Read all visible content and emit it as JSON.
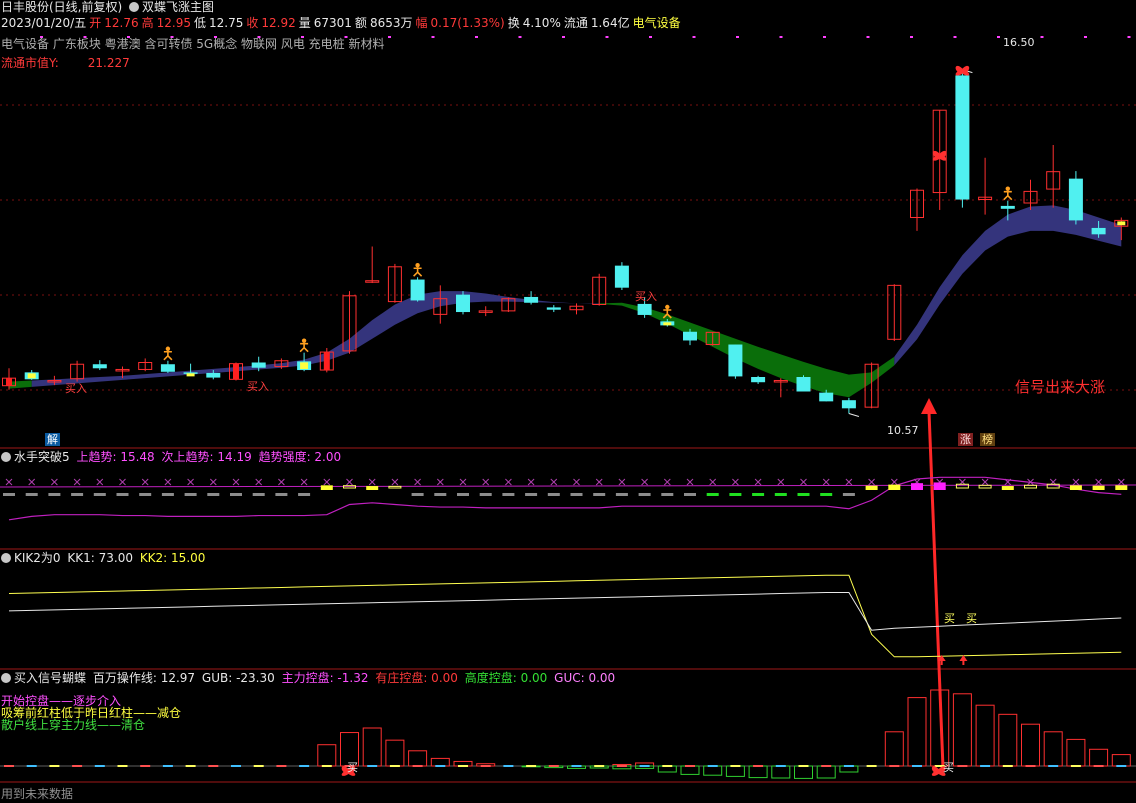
{
  "header": {
    "stock": "日丰股份(日线,前复权)",
    "template": "双蝶飞涨主图",
    "date": "2023/01/20/五",
    "open_label": "开",
    "open": "12.76",
    "high_label": "高",
    "high": "12.95",
    "low_label": "低",
    "low": "12.75",
    "close_label": "收",
    "close": "12.92",
    "vol_label": "量",
    "vol": "67301",
    "amount_label": "额",
    "amount": "8653万",
    "chg_label": "幅",
    "chg": "0.17(1.33%)",
    "turnover_label": "换",
    "turnover": "4.10%",
    "float_label": "流通",
    "float": "1.64亿",
    "sector": "电气设备",
    "concepts": "电气设备 广东板块 粤港澳 含可转债 5G概念 物联网 风电 充电桩 新材料",
    "mcap_label": "流通市值Y:",
    "mcap": "21.227"
  },
  "annotations": {
    "buy1": "买入",
    "buy2": "买入",
    "buy3": "买入",
    "high_price": "16.50",
    "low_price": "10.57",
    "signal_text": "信号出来大涨",
    "jie": "解",
    "zhang": "涨",
    "bang": "榜"
  },
  "panel2": {
    "name": "水手突破5",
    "l1": "上趋势: 15.48",
    "l2": "次上趋势: 14.19",
    "l3": "趋势强度: 2.00"
  },
  "panel3": {
    "name": "KIK2为0",
    "l1": "KK1: 73.00",
    "l2": "KK2: 15.00",
    "buy_a": "买",
    "buy_b": "买"
  },
  "panel4": {
    "name": "买入信号蝴蝶",
    "l1": "百万操作线: 12.97",
    "l2": "GUB: -23.30",
    "l3": "主力控盘: -1.32",
    "l4": "有庄控盘: 0.00",
    "l5": "高度控盘: 0.00",
    "l6": "GUC: 0.00",
    "legend1": "开始控盘——逐步介入",
    "legend2": "吸筹前红柱低于昨日红柱——减仓",
    "legend3": "散户线上穿主力线——清仓",
    "buy_mark1": "买",
    "buy_mark2": "买",
    "footer": "用到未来数据"
  },
  "colors": {
    "up": "#ff3030",
    "down": "#50f0f0",
    "band_up": "#34347c",
    "band_down": "#0a6e0a",
    "grid": "#7a1010",
    "sep": "#a01818"
  },
  "chart_data": {
    "type": "candlestick",
    "x_count": 50,
    "ylim": [
      10.2,
      16.7
    ],
    "candles": [
      {
        "o": 11.05,
        "h": 11.35,
        "l": 10.98,
        "c": 11.18
      },
      {
        "o": 11.28,
        "h": 11.32,
        "l": 11.15,
        "c": 11.16
      },
      {
        "o": 11.12,
        "h": 11.22,
        "l": 11.06,
        "c": 11.14
      },
      {
        "o": 11.17,
        "h": 11.48,
        "l": 11.12,
        "c": 11.42
      },
      {
        "o": 11.42,
        "h": 11.49,
        "l": 11.32,
        "c": 11.35
      },
      {
        "o": 11.32,
        "h": 11.38,
        "l": 11.18,
        "c": 11.33
      },
      {
        "o": 11.33,
        "h": 11.52,
        "l": 11.3,
        "c": 11.45
      },
      {
        "o": 11.42,
        "h": 11.48,
        "l": 11.27,
        "c": 11.29
      },
      {
        "o": 11.28,
        "h": 11.43,
        "l": 11.22,
        "c": 11.26
      },
      {
        "o": 11.27,
        "h": 11.32,
        "l": 11.16,
        "c": 11.19
      },
      {
        "o": 11.16,
        "h": 11.45,
        "l": 11.14,
        "c": 11.43
      },
      {
        "o": 11.45,
        "h": 11.55,
        "l": 11.3,
        "c": 11.36
      },
      {
        "o": 11.38,
        "h": 11.52,
        "l": 11.34,
        "c": 11.48
      },
      {
        "o": 11.47,
        "h": 11.62,
        "l": 11.3,
        "c": 11.32
      },
      {
        "o": 11.32,
        "h": 11.7,
        "l": 11.28,
        "c": 11.63
      },
      {
        "o": 11.65,
        "h": 12.68,
        "l": 11.6,
        "c": 12.6
      },
      {
        "o": 12.85,
        "h": 13.45,
        "l": 12.82,
        "c": 12.86
      },
      {
        "o": 12.5,
        "h": 13.15,
        "l": 12.48,
        "c": 13.1
      },
      {
        "o": 12.88,
        "h": 12.92,
        "l": 12.5,
        "c": 12.52
      },
      {
        "o": 12.28,
        "h": 12.78,
        "l": 12.12,
        "c": 12.55
      },
      {
        "o": 12.62,
        "h": 12.68,
        "l": 12.28,
        "c": 12.32
      },
      {
        "o": 12.33,
        "h": 12.42,
        "l": 12.25,
        "c": 12.34
      },
      {
        "o": 12.34,
        "h": 12.57,
        "l": 12.32,
        "c": 12.55
      },
      {
        "o": 12.58,
        "h": 12.68,
        "l": 12.45,
        "c": 12.48
      },
      {
        "o": 12.4,
        "h": 12.44,
        "l": 12.32,
        "c": 12.36
      },
      {
        "o": 12.36,
        "h": 12.47,
        "l": 12.28,
        "c": 12.42
      },
      {
        "o": 12.45,
        "h": 12.98,
        "l": 12.43,
        "c": 12.92
      },
      {
        "o": 13.12,
        "h": 13.18,
        "l": 12.7,
        "c": 12.74
      },
      {
        "o": 12.46,
        "h": 12.58,
        "l": 12.22,
        "c": 12.27
      },
      {
        "o": 12.16,
        "h": 12.2,
        "l": 12.07,
        "c": 12.09
      },
      {
        "o": 11.98,
        "h": 12.03,
        "l": 11.75,
        "c": 11.83
      },
      {
        "o": 11.76,
        "h": 11.97,
        "l": 11.74,
        "c": 11.97
      },
      {
        "o": 11.76,
        "h": 11.76,
        "l": 11.17,
        "c": 11.21
      },
      {
        "o": 11.2,
        "h": 11.22,
        "l": 11.08,
        "c": 11.11
      },
      {
        "o": 11.14,
        "h": 11.18,
        "l": 10.85,
        "c": 11.14
      },
      {
        "o": 11.2,
        "h": 11.23,
        "l": 10.95,
        "c": 10.95
      },
      {
        "o": 10.93,
        "h": 10.98,
        "l": 10.78,
        "c": 10.78
      },
      {
        "o": 10.8,
        "h": 10.84,
        "l": 10.57,
        "c": 10.66
      },
      {
        "o": 10.68,
        "h": 11.45,
        "l": 10.66,
        "c": 11.42
      },
      {
        "o": 11.85,
        "h": 12.8,
        "l": 11.82,
        "c": 12.78
      },
      {
        "o": 13.95,
        "h": 14.45,
        "l": 13.72,
        "c": 14.42
      },
      {
        "o": 14.38,
        "h": 15.8,
        "l": 14.08,
        "c": 15.8
      },
      {
        "o": 16.4,
        "h": 16.5,
        "l": 14.12,
        "c": 14.26
      },
      {
        "o": 14.26,
        "h": 14.98,
        "l": 14.0,
        "c": 14.3
      },
      {
        "o": 14.15,
        "h": 14.24,
        "l": 13.9,
        "c": 14.1
      },
      {
        "o": 14.2,
        "h": 14.6,
        "l": 14.08,
        "c": 14.4
      },
      {
        "o": 14.44,
        "h": 15.2,
        "l": 14.12,
        "c": 14.74
      },
      {
        "o": 14.62,
        "h": 14.75,
        "l": 13.83,
        "c": 13.9
      },
      {
        "o": 13.77,
        "h": 13.89,
        "l": 13.6,
        "c": 13.66
      },
      {
        "o": 13.8,
        "h": 13.95,
        "l": 13.56,
        "c": 13.9
      }
    ],
    "band_top": [
      11.12,
      11.14,
      11.16,
      11.18,
      11.2,
      11.22,
      11.25,
      11.28,
      11.31,
      11.34,
      11.37,
      11.4,
      11.44,
      11.5,
      11.62,
      11.86,
      12.18,
      12.45,
      12.62,
      12.68,
      12.68,
      12.64,
      12.58,
      12.53,
      12.49,
      12.47,
      12.47,
      12.48,
      12.4,
      12.28,
      12.14,
      12.0,
      11.86,
      11.72,
      11.59,
      11.46,
      11.34,
      11.24,
      11.28,
      11.55,
      12.1,
      12.75,
      13.3,
      13.72,
      14.0,
      14.14,
      14.16,
      14.08,
      13.95,
      13.82
    ],
    "band_bot": [
      11.0,
      11.03,
      11.06,
      11.09,
      11.12,
      11.15,
      11.18,
      11.21,
      11.24,
      11.27,
      11.3,
      11.33,
      11.36,
      11.4,
      11.48,
      11.62,
      11.86,
      12.1,
      12.3,
      12.42,
      12.48,
      12.5,
      12.5,
      12.49,
      12.48,
      12.47,
      12.46,
      12.43,
      12.3,
      12.12,
      11.92,
      11.72,
      11.52,
      11.34,
      11.18,
      11.04,
      10.92,
      10.85,
      11.1,
      11.4,
      11.85,
      12.45,
      12.98,
      13.38,
      13.62,
      13.72,
      13.72,
      13.65,
      13.55,
      13.45
    ],
    "panel2_purple": [
      0.32,
      0.36,
      0.38,
      0.38,
      0.38,
      0.37,
      0.37,
      0.36,
      0.36,
      0.36,
      0.36,
      0.37,
      0.37,
      0.37,
      0.38,
      0.5,
      0.52,
      0.5,
      0.48,
      0.47,
      0.47,
      0.46,
      0.46,
      0.46,
      0.46,
      0.46,
      0.46,
      0.48,
      0.48,
      0.48,
      0.48,
      0.48,
      0.48,
      0.48,
      0.48,
      0.48,
      0.48,
      0.45,
      0.55,
      0.72,
      0.8,
      0.82,
      0.82,
      0.82,
      0.79,
      0.76,
      0.73,
      0.68,
      0.64,
      0.62
    ],
    "panel2_bars": [
      {
        "k": "gray",
        "v": 0.18
      },
      {
        "k": "gray",
        "v": 0.16
      },
      {
        "k": "gray",
        "v": 0.14
      },
      {
        "k": "gray",
        "v": 0.14
      },
      {
        "k": "gray",
        "v": 0.16
      },
      {
        "k": "gray",
        "v": 0.14
      },
      {
        "k": "gray",
        "v": 0.16
      },
      {
        "k": "gray",
        "v": 0.16
      },
      {
        "k": "gray",
        "v": 0.18
      },
      {
        "k": "gray",
        "v": 0.14
      },
      {
        "k": "gray",
        "v": 0.18
      },
      {
        "k": "gray",
        "v": 0.16
      },
      {
        "k": "gray",
        "v": 0.18
      },
      {
        "k": "gray",
        "v": 0.2
      },
      {
        "k": "yellow",
        "v": 0.26
      },
      {
        "k": "open",
        "v": 0.24
      },
      {
        "k": "yellow",
        "v": 0.22
      },
      {
        "k": "open",
        "v": 0.2
      },
      {
        "k": "gray",
        "v": 0.18
      },
      {
        "k": "gray",
        "v": 0.2
      },
      {
        "k": "gray",
        "v": 0.22
      },
      {
        "k": "gray",
        "v": 0.22
      },
      {
        "k": "gray",
        "v": 0.22
      },
      {
        "k": "gray",
        "v": 0.2
      },
      {
        "k": "gray",
        "v": 0.2
      },
      {
        "k": "gray",
        "v": 0.22
      },
      {
        "k": "gray",
        "v": 0.24
      },
      {
        "k": "gray",
        "v": 0.26
      },
      {
        "k": "gray",
        "v": 0.2
      },
      {
        "k": "gray",
        "v": 0.18
      },
      {
        "k": "gray",
        "v": 0.16
      },
      {
        "k": "green",
        "v": 0.16
      },
      {
        "k": "green",
        "v": 0.16
      },
      {
        "k": "green",
        "v": 0.18
      },
      {
        "k": "green",
        "v": 0.18
      },
      {
        "k": "green",
        "v": 0.16
      },
      {
        "k": "green",
        "v": 0.16
      },
      {
        "k": "gray",
        "v": 0.22
      },
      {
        "k": "yellow",
        "v": 0.24
      },
      {
        "k": "yellow",
        "v": 0.3
      },
      {
        "k": "magenta",
        "v": 0.38
      },
      {
        "k": "magenta",
        "v": 0.42
      },
      {
        "k": "open",
        "v": 0.32
      },
      {
        "k": "open",
        "v": 0.26
      },
      {
        "k": "yellow",
        "v": 0.22
      },
      {
        "k": "open",
        "v": 0.26
      },
      {
        "k": "open",
        "v": 0.32
      },
      {
        "k": "yellow",
        "v": 0.26
      },
      {
        "k": "yellow",
        "v": 0.24
      },
      {
        "k": "yellow",
        "v": 0.26
      }
    ],
    "panel3_yellow": [
      0.72,
      0.725,
      0.73,
      0.735,
      0.74,
      0.745,
      0.75,
      0.755,
      0.76,
      0.765,
      0.77,
      0.775,
      0.78,
      0.785,
      0.79,
      0.795,
      0.8,
      0.805,
      0.81,
      0.815,
      0.82,
      0.825,
      0.83,
      0.835,
      0.84,
      0.845,
      0.85,
      0.855,
      0.86,
      0.865,
      0.87,
      0.875,
      0.88,
      0.885,
      0.89,
      0.895,
      0.9,
      0.9,
      0.32,
      0.1,
      0.1,
      0.105,
      0.11,
      0.115,
      0.12,
      0.125,
      0.13,
      0.135,
      0.14,
      0.145
    ],
    "panel3_white": [
      0.55,
      0.555,
      0.56,
      0.565,
      0.57,
      0.575,
      0.58,
      0.585,
      0.59,
      0.595,
      0.6,
      0.605,
      0.61,
      0.615,
      0.62,
      0.625,
      0.63,
      0.635,
      0.64,
      0.645,
      0.65,
      0.655,
      0.66,
      0.665,
      0.67,
      0.675,
      0.68,
      0.685,
      0.69,
      0.695,
      0.7,
      0.705,
      0.71,
      0.715,
      0.72,
      0.725,
      0.73,
      0.73,
      0.36,
      0.38,
      0.39,
      0.4,
      0.41,
      0.42,
      0.43,
      0.44,
      0.45,
      0.46,
      0.47,
      0.48
    ],
    "panel4_red": [
      0,
      0,
      0,
      0,
      0,
      0,
      0,
      0,
      0,
      0,
      0,
      0,
      0,
      0,
      0.28,
      0.44,
      0.5,
      0.34,
      0.2,
      0.1,
      0.06,
      0.03,
      0,
      0,
      0,
      0,
      0,
      0.02,
      0.04,
      0,
      0,
      0,
      0,
      0,
      0,
      0,
      0,
      0,
      0,
      0.45,
      0.9,
      1.0,
      0.95,
      0.8,
      0.68,
      0.55,
      0.45,
      0.35,
      0.22,
      0.15
    ],
    "panel4_green": [
      0,
      0,
      0,
      0,
      0,
      0,
      0,
      0,
      0,
      0,
      0,
      0,
      0,
      0,
      0,
      0,
      0,
      0,
      0,
      0,
      0,
      0,
      0,
      0.04,
      0.08,
      0.12,
      0.1,
      0.14,
      0.12,
      0.3,
      0.42,
      0.46,
      0.52,
      0.58,
      0.6,
      0.62,
      0.6,
      0.3,
      0,
      0,
      0,
      0,
      0,
      0,
      0,
      0,
      0,
      0,
      0,
      0
    ]
  }
}
